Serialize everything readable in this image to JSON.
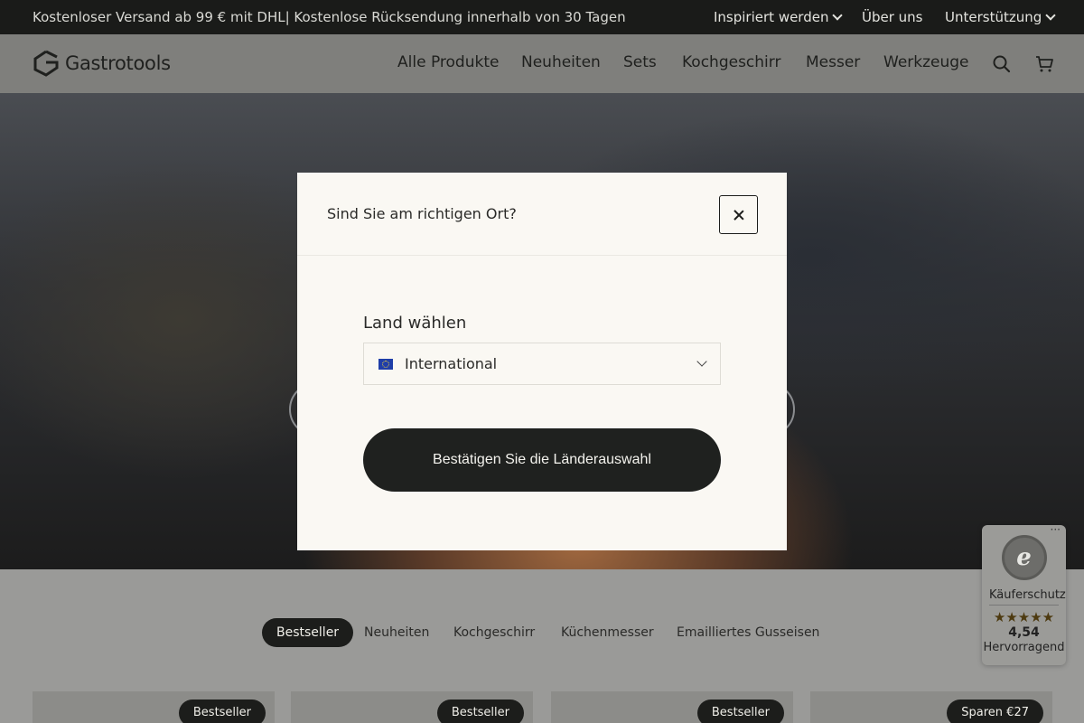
{
  "topbar": {
    "promo": "Kostenloser Versand ab 99 € mit DHL| Kostenlose Rücksendung innerhalb von 30 Tagen",
    "links": {
      "inspire": "Inspiriert werden",
      "about": "Über uns",
      "support": "Unterstützung"
    }
  },
  "header": {
    "logo_text": "Gastrotools",
    "nav": {
      "all": "Alle Produkte",
      "new": "Neuheiten",
      "sets": "Sets",
      "cookware": "Kochgeschirr",
      "knives": "Messer",
      "tools": "Werkzeuge"
    },
    "icons": [
      "search-icon",
      "cart-icon"
    ]
  },
  "tabs": {
    "bestseller": "Bestseller",
    "new": "Neuheiten",
    "cookware": "Kochgeschirr",
    "kitchen_knives": "Küchenmesser",
    "enamel": "Emailliertes Gusseisen"
  },
  "cards": [
    {
      "badge": "Bestseller"
    },
    {
      "badge": "Bestseller"
    },
    {
      "badge": "Bestseller"
    },
    {
      "badge": "Sparen €27"
    }
  ],
  "trusted_shops": {
    "seal_letter": "e",
    "protection": "Käuferschutz",
    "stars": "★★★★★",
    "score": "4,54",
    "verdict": "Hervorragend"
  },
  "modal": {
    "title": "Sind Sie am richtigen Ort?",
    "country_label": "Land wählen",
    "country_value": "International",
    "confirm": "Bestätigen Sie die Länderauswahl"
  },
  "colors": {
    "dark": "#1c1d1b",
    "modal_bg": "#faf8f3",
    "overlay": "#7f7f7c"
  }
}
